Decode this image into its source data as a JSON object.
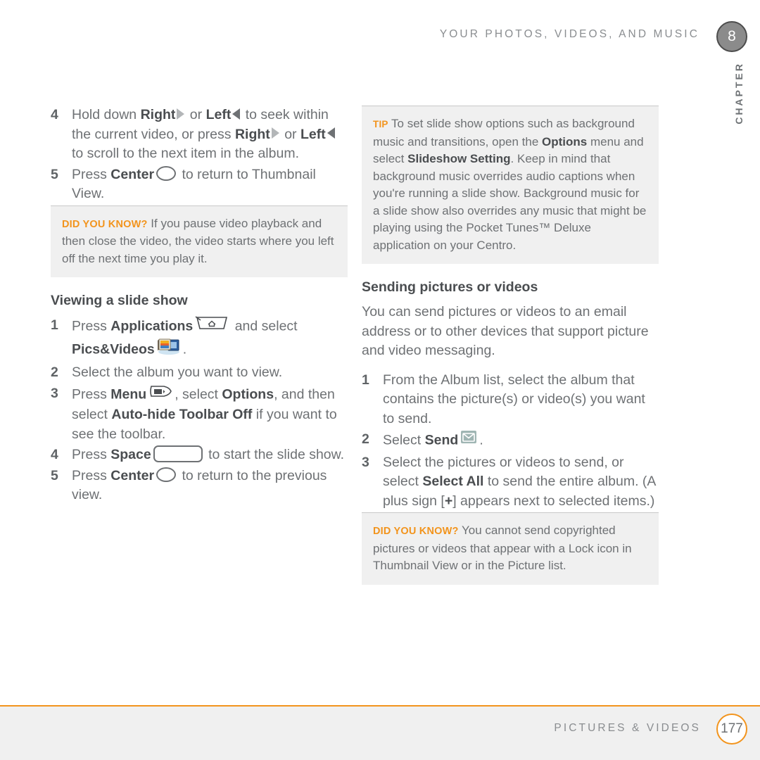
{
  "header": {
    "title": "YOUR PHOTOS, VIDEOS, AND MUSIC",
    "chapter_number": "8",
    "chapter_label": "CHAPTER"
  },
  "footer": {
    "title": "PICTURES & VIDEOS",
    "page_number": "177",
    "rule_color": "#f2941d"
  },
  "colors": {
    "accent_orange": "#f2941d",
    "body_text": "#6e7174",
    "bold_text": "#4a4d50",
    "callout_bg": "#f0f0f0"
  },
  "left_column": {
    "steps_continued": [
      {
        "num": "4",
        "parts": [
          {
            "t": "Hold down "
          },
          {
            "t": "Right",
            "b": true
          },
          {
            "icon": "arrow-right-icon"
          },
          {
            "t": " or "
          },
          {
            "t": "Left",
            "b": true
          },
          {
            "icon": "arrow-left-icon"
          },
          {
            "t": " to seek within the current video, or press "
          },
          {
            "t": "Right",
            "b": true
          },
          {
            "icon": "arrow-right-icon"
          },
          {
            "t": " or "
          },
          {
            "t": "Left",
            "b": true
          },
          {
            "icon": "arrow-left-icon"
          },
          {
            "t": " to scroll to the next item in the album."
          }
        ]
      },
      {
        "num": "5",
        "parts": [
          {
            "t": "Press "
          },
          {
            "t": "Center",
            "b": true
          },
          {
            "icon": "center-key-icon"
          },
          {
            "t": " to return to Thumbnail View."
          }
        ]
      }
    ],
    "did_you_know": {
      "label": "DID YOU KNOW?",
      "text": "If you pause video playback and then close the video, the video starts where you left off the next time you play it."
    },
    "section_heading": "Viewing a slide show",
    "steps": [
      {
        "num": "1",
        "parts": [
          {
            "t": "Press "
          },
          {
            "t": "Applications",
            "b": true
          },
          {
            "icon": "applications-key-icon"
          },
          {
            "t": " and select "
          },
          {
            "t": "Pics&Videos",
            "b": true
          },
          {
            "icon": "pics-and-videos-icon"
          },
          {
            "t": "."
          }
        ]
      },
      {
        "num": "2",
        "parts": [
          {
            "t": "Select the album you want to view."
          }
        ]
      },
      {
        "num": "3",
        "parts": [
          {
            "t": "Press "
          },
          {
            "t": "Menu",
            "b": true
          },
          {
            "icon": "menu-key-icon"
          },
          {
            "t": ", select "
          },
          {
            "t": "Options",
            "b": true
          },
          {
            "t": ", and then select "
          },
          {
            "t": "Auto-hide Toolbar Off",
            "b": true
          },
          {
            "t": " if you want to see the toolbar."
          }
        ]
      },
      {
        "num": "4",
        "parts": [
          {
            "t": "Press "
          },
          {
            "t": "Space",
            "b": true
          },
          {
            "icon": "space-key-icon"
          },
          {
            "t": " to start the slide show."
          }
        ]
      },
      {
        "num": "5",
        "parts": [
          {
            "t": "Press "
          },
          {
            "t": "Center",
            "b": true
          },
          {
            "icon": "center-key-icon"
          },
          {
            "t": " to return to the previous view."
          }
        ]
      }
    ]
  },
  "right_column": {
    "tip": {
      "label": "TIP",
      "parts": [
        {
          "t": "To set slide show options such as background music and transitions, open the "
        },
        {
          "t": "Options",
          "b": true
        },
        {
          "t": " menu and select "
        },
        {
          "t": "Slideshow Setting",
          "b": true
        },
        {
          "t": ". Keep in mind that background music overrides audio captions when you're running a slide show. Background music for a slide show also overrides any music that might be playing using the Pocket Tunes™ Deluxe application on your Centro."
        }
      ]
    },
    "section_heading": "Sending pictures or videos",
    "intro": "You can send pictures or videos to an email address or to other devices that support picture and video messaging.",
    "steps": [
      {
        "num": "1",
        "parts": [
          {
            "t": "From the Album list, select the album that contains the picture(s) or video(s) you want to send."
          }
        ]
      },
      {
        "num": "2",
        "parts": [
          {
            "t": "Select "
          },
          {
            "t": "Send",
            "b": true
          },
          {
            "icon": "send-envelope-icon"
          },
          {
            "t": "."
          }
        ]
      },
      {
        "num": "3",
        "parts": [
          {
            "t": "Select the pictures or videos to send, or select "
          },
          {
            "t": "Select All",
            "b": true
          },
          {
            "t": " to send the entire album. (A plus sign ["
          },
          {
            "t": "+",
            "b": true
          },
          {
            "t": "] appears next to selected items.)"
          }
        ]
      }
    ],
    "did_you_know": {
      "label": "DID YOU KNOW?",
      "text": "You cannot send copyrighted pictures or videos that appear with a Lock icon in Thumbnail View or in the Picture list."
    }
  }
}
